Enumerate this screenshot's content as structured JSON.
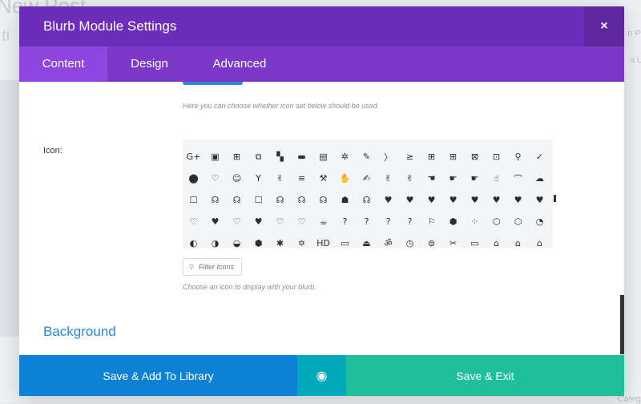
{
  "background": {
    "title": "New Post",
    "subtitle": "r ti",
    "right_label": "n Pa",
    "right_label2": "a La",
    "bottom_label": "Catego"
  },
  "modal": {
    "title": "Blurb Module Settings",
    "close_symbol": "×",
    "tabs": [
      {
        "label": "Content",
        "active": true
      },
      {
        "label": "Design",
        "active": false
      },
      {
        "label": "Advanced",
        "active": false
      }
    ],
    "use_icon_description": "Here you can choose whether icon set below should be used.",
    "icon_label": "Icon:",
    "icon_grid": {
      "rows": [
        [
          "G+",
          "▣",
          "⊞",
          "⧉",
          "▚",
          "▬",
          "▤",
          "✲",
          "✎",
          "〉",
          "≥",
          "⊞",
          "⊞",
          "⊠",
          "⊡",
          "⚲",
          "✓"
        ],
        [
          "⬤",
          "♡",
          "☺",
          "Y",
          "✌",
          "≡",
          "⚒",
          "✋",
          "✍",
          "✌",
          "✌",
          "☚",
          "☛",
          "☛",
          "☝",
          "⌒",
          "☁"
        ],
        [
          "☐",
          "☊",
          "☊",
          "☐",
          "☊",
          "☊",
          "☊",
          "☗",
          "☊",
          "♥",
          "♥",
          "♥",
          "♥",
          "♥",
          "♥",
          "♥",
          "♥"
        ],
        [
          "♡",
          "♥",
          "♡",
          "♥",
          "♡",
          "♡",
          "☕",
          "?",
          "?",
          "?",
          "?",
          "⚐",
          "⬢",
          "⁘",
          "⬡",
          "⬡",
          "◔"
        ],
        [
          "◐",
          "◑",
          "◒",
          "⬢",
          "✱",
          "✡",
          "HD",
          "▭",
          "⏏",
          "ॐ",
          "◷",
          "⊜",
          "✂",
          "▭",
          "⌂",
          "⌂",
          "⌂"
        ]
      ]
    },
    "icon_description": "Choose an icon to display with your blurb.",
    "filter_placeholder": "Filter Icons",
    "filter_icon_symbol": "⚲",
    "section_background": "Background",
    "footer": {
      "library_label": "Save & Add To Library",
      "preview_symbol": "◉",
      "save_label": "Save & Exit"
    }
  },
  "colors": {
    "header": "#6c2eb9",
    "tabs": "#7b38c9",
    "active_tab": "#8f46e0",
    "accent_blue": "#2b87da",
    "library_button": "#0c81d6",
    "preview_button": "#00a8b8",
    "save_button": "#1fbf9b"
  }
}
